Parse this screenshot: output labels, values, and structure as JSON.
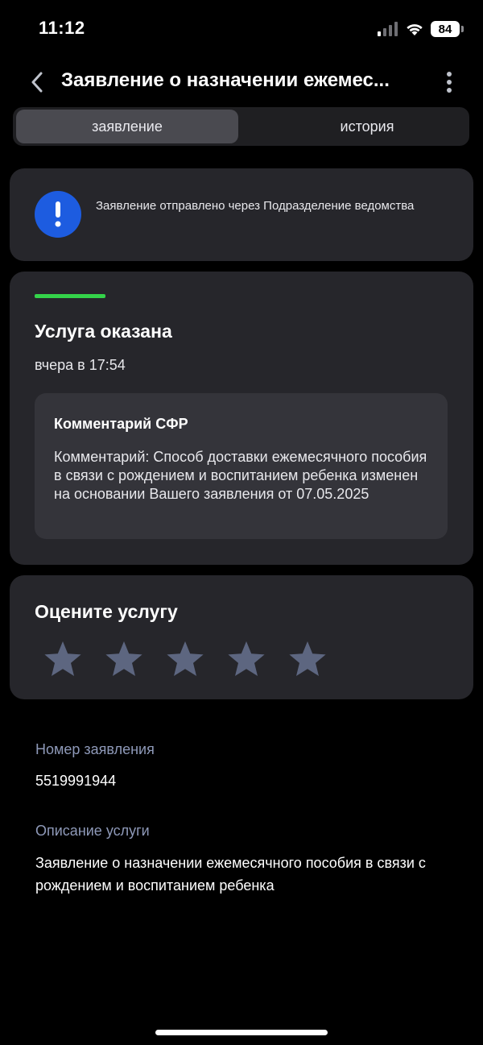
{
  "status_bar": {
    "time": "11:12",
    "battery": "84"
  },
  "header": {
    "title": "Заявление о назначении ежемес..."
  },
  "tabs": [
    {
      "label": "заявление",
      "active": true
    },
    {
      "label": "история",
      "active": false
    }
  ],
  "info_banner": {
    "icon": "exclamation-icon",
    "text": "Заявление отправлено через Подразделение ведомства",
    "icon_color": "#1d5ce0"
  },
  "status_card": {
    "accent_color": "#34d34a",
    "title": "Услуга оказана",
    "time": "вчера в 17:54",
    "comment": {
      "title": "Комментарий СФР",
      "text": "Комментарий: Способ доставки ежемесячного пособия в связи с рождением и воспитанием ребенка изменен на основании Вашего заявления от 07.05.2025"
    }
  },
  "rating": {
    "title": "Оцените услугу",
    "max_stars": 5,
    "selected": 0
  },
  "details": {
    "number_label": "Номер заявления",
    "number_value": "5519991944",
    "description_label": "Описание услуги",
    "description_value": "Заявление о назначении ежемесячного пособия в связи с рождением и воспитанием ребенка"
  }
}
